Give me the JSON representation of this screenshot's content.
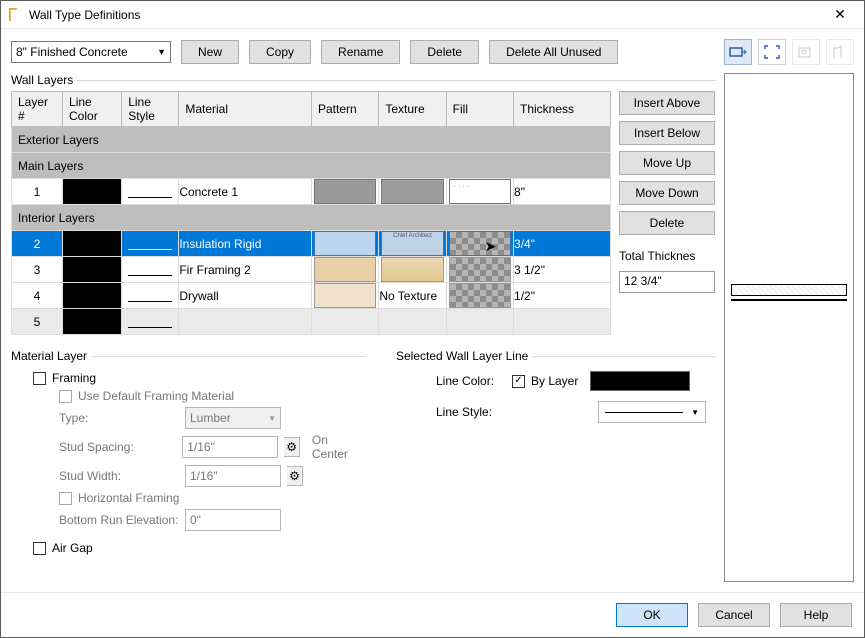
{
  "window": {
    "title": "Wall Type Definitions"
  },
  "combo": {
    "selected": "8\" Finished Concrete"
  },
  "buttons": {
    "new": "New",
    "copy": "Copy",
    "rename": "Rename",
    "delete": "Delete",
    "deleteUnused": "Delete All Unused"
  },
  "layersGroup": "Wall Layers",
  "headers": {
    "layerNum": "Layer #",
    "lineColor": "Line Color",
    "lineStyle": "Line Style",
    "material": "Material",
    "pattern": "Pattern",
    "texture": "Texture",
    "fill": "Fill",
    "thickness": "Thickness"
  },
  "groups": {
    "exterior": "Exterior Layers",
    "main": "Main Layers",
    "interior": "Interior Layers"
  },
  "rows": {
    "r1": {
      "num": "1",
      "material": "Concrete 1",
      "thk": "8\""
    },
    "r2": {
      "num": "2",
      "material": "Insulation Rigid",
      "thk": "3/4\""
    },
    "r3": {
      "num": "3",
      "material": "Fir Framing 2",
      "thk": "3 1/2\""
    },
    "r4": {
      "num": "4",
      "material": "Drywall",
      "texture": "No Texture",
      "thk": "1/2\""
    },
    "r5": {
      "num": "5"
    }
  },
  "side": {
    "insertAbove": "Insert Above",
    "insertBelow": "Insert Below",
    "moveUp": "Move Up",
    "moveDown": "Move Down",
    "delete": "Delete",
    "totalLabel": "Total Thicknes",
    "totalValue": "12 3/4\""
  },
  "matLayer": {
    "legend": "Material Layer",
    "framing": "Framing",
    "useDefault": "Use Default Framing Material",
    "type": "Type:",
    "typeVal": "Lumber",
    "spacing": "Stud Spacing:",
    "spacingVal": "1/16\"",
    "onCenter": "On Center",
    "width": "Stud Width:",
    "widthVal": "1/16\"",
    "horiz": "Horizontal Framing",
    "bottom": "Bottom Run Elevation:",
    "bottomVal": "0\"",
    "airgap": "Air Gap"
  },
  "lineSel": {
    "legend": "Selected Wall Layer Line",
    "color": "Line Color:",
    "byLayer": "By Layer",
    "style": "Line Style:"
  },
  "footer": {
    "ok": "OK",
    "cancel": "Cancel",
    "help": "Help"
  }
}
